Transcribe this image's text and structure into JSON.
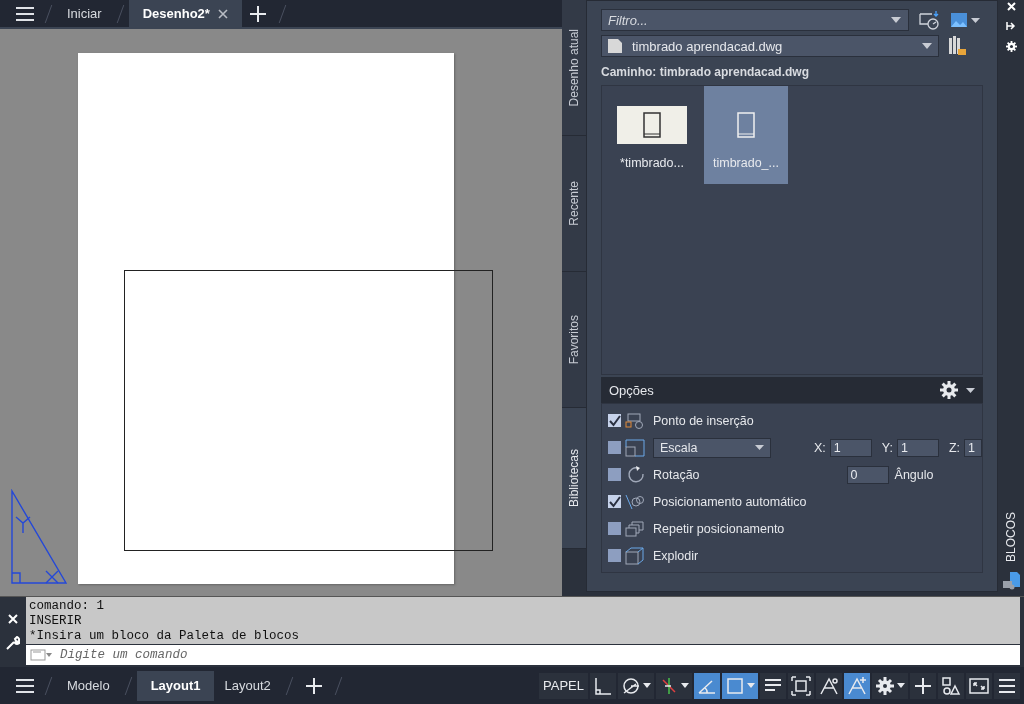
{
  "file_tabs": [
    {
      "label": "Iniciar",
      "selected": false,
      "closable": false
    },
    {
      "label": "Desenho2*",
      "selected": true,
      "closable": true
    }
  ],
  "palette": {
    "side_tabs": [
      {
        "label": "Desenho atual",
        "selected": false
      },
      {
        "label": "Recente",
        "selected": false
      },
      {
        "label": "Favoritos",
        "selected": false
      },
      {
        "label": "Bibliotecas",
        "selected": true
      }
    ],
    "filter": {
      "placeholder": "Filtro..."
    },
    "library": "timbrado aprendacad.dwg",
    "path": "Caminho: timbrado aprendacad.dwg",
    "blocks": [
      {
        "name": "*timbrado...",
        "selected": false
      },
      {
        "name": "timbrado_...",
        "selected": true
      }
    ],
    "options_title": "Opções",
    "options": [
      {
        "kind": "check",
        "label": "Ponto de inserção",
        "checked": true
      },
      {
        "kind": "scale",
        "select": "Escala",
        "checked": false,
        "fields": [
          {
            "label": "X:",
            "value": "1"
          },
          {
            "label": "Y:",
            "value": "1"
          },
          {
            "label": "Z:",
            "value": "1"
          }
        ]
      },
      {
        "kind": "rotation",
        "label": "Rotação",
        "checked": false,
        "value": "0",
        "unit": "Ângulo"
      },
      {
        "kind": "check",
        "label": "Posicionamento automático",
        "checked": true
      },
      {
        "kind": "check",
        "label": "Repetir posicionamento",
        "checked": false
      },
      {
        "kind": "check",
        "label": "Explodir",
        "checked": false
      }
    ],
    "strip_title": "BLOCOS"
  },
  "command": {
    "history": [
      "comando: 1",
      "INSERIR",
      "*Insira um bloco da Paleta de blocos"
    ],
    "placeholder": "Digite um comando"
  },
  "layout_tabs": [
    {
      "label": "Modelo",
      "selected": false
    },
    {
      "label": "Layout1",
      "selected": true
    },
    {
      "label": "Layout2",
      "selected": false
    }
  ],
  "status": [
    {
      "kind": "text",
      "label": "PAPEL",
      "on": false
    },
    {
      "kind": "ortho",
      "on": false
    },
    {
      "kind": "polar",
      "on": false,
      "caret": true
    },
    {
      "kind": "tracking",
      "on": false,
      "caret": true
    },
    {
      "kind": "angle",
      "on": true
    },
    {
      "kind": "square",
      "on": true,
      "caret": true
    },
    {
      "kind": "lineweight",
      "on": false
    },
    {
      "kind": "selection",
      "on": false
    },
    {
      "kind": "annotation",
      "on": false
    },
    {
      "kind": "autoscale",
      "on": true
    },
    {
      "kind": "gear",
      "on": false,
      "caret": true
    },
    {
      "kind": "plus",
      "on": false
    },
    {
      "kind": "shapes",
      "on": false
    },
    {
      "kind": "fullscreen",
      "on": false
    },
    {
      "kind": "menu",
      "on": false
    }
  ]
}
